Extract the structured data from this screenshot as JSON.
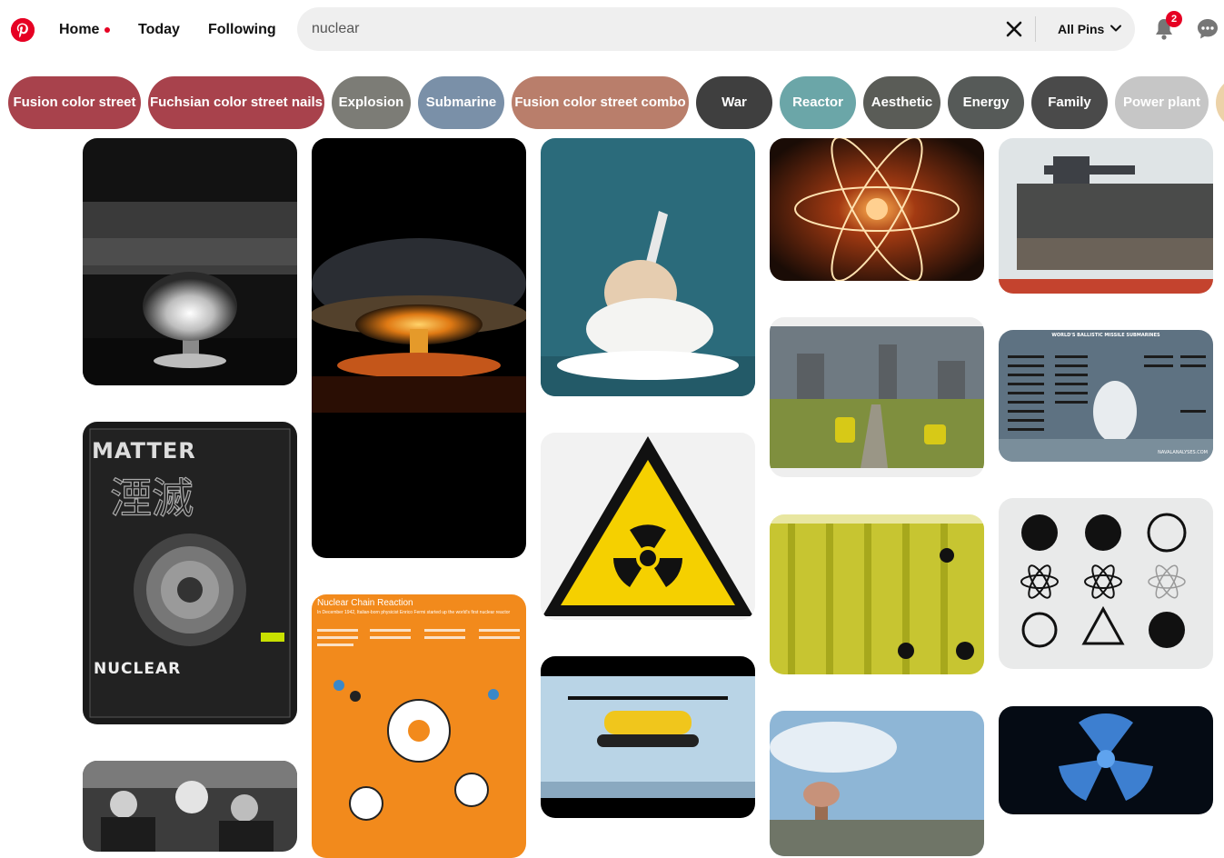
{
  "header": {
    "logo_icon": "pinterest-logo",
    "nav": {
      "home": "Home",
      "today": "Today",
      "following": "Following"
    },
    "search": {
      "value": "nuclear",
      "clear_icon": "close-icon",
      "filter_label": "All Pins",
      "filter_icon": "chevron-down-icon"
    },
    "notifications": {
      "icon": "bell-icon",
      "count": "2"
    },
    "messages_icon": "chat-bubble-icon"
  },
  "pills": [
    {
      "label": "Fusion color street",
      "color": "#a8424c"
    },
    {
      "label": "Fuchsian color street nails",
      "color": "#a8424c"
    },
    {
      "label": "Explosion",
      "color": "#7c7c76"
    },
    {
      "label": "Submarine",
      "color": "#7a90a8"
    },
    {
      "label": "Fusion color street combo",
      "color": "#b97e6b"
    },
    {
      "label": "War",
      "color": "#3f3f3f"
    },
    {
      "label": "Reactor",
      "color": "#6ba6a8"
    },
    {
      "label": "Aesthetic",
      "color": "#5a5c57"
    },
    {
      "label": "Energy",
      "color": "#565a58"
    },
    {
      "label": "Family",
      "color": "#4a4a4a"
    },
    {
      "label": "Power plant",
      "color": "#c6c6c6"
    },
    {
      "label": "",
      "color": "#ecd2a8"
    }
  ],
  "pins": {
    "matter_poster": {
      "header_text": "MATTER",
      "footer_text": "NUCLEAR"
    },
    "chain_reaction": {
      "title": "Nuclear Chain Reaction",
      "subtitle": "In December 1942, Italian-born physicist Enrico Fermi started up the world's first nuclear reactor"
    },
    "submarine_chart": {
      "title": "WORLD'S BALLISTIC MISSILE SUBMARINES",
      "credit": "NAVALANALYSES.COM"
    }
  }
}
